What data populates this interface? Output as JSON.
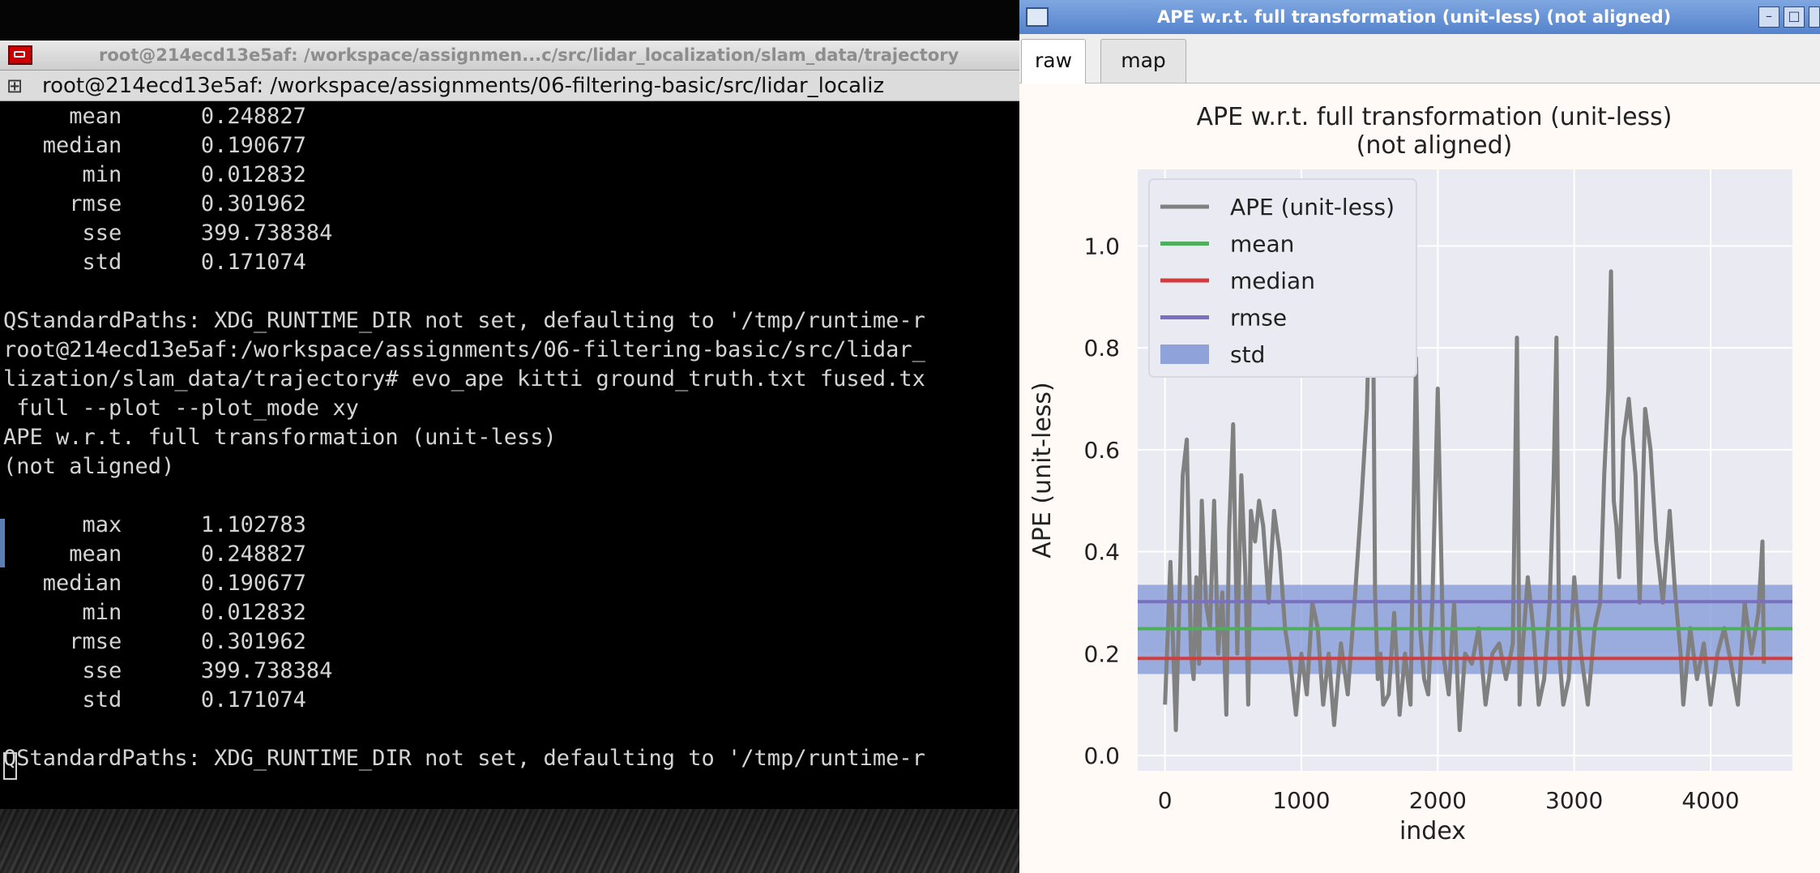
{
  "terminal": {
    "title": "root@214ecd13e5af: /workspace/assignmen...c/src/lidar_localization/slam_data/trajectory",
    "tab_label": "root@214ecd13e5af: /workspace/assignments/06-filtering-basic/src/lidar_localiz",
    "lines": [
      "     mean      0.248827",
      "   median      0.190677",
      "      min      0.012832",
      "     rmse      0.301962",
      "      sse      399.738384",
      "      std      0.171074",
      "",
      "QStandardPaths: XDG_RUNTIME_DIR not set, defaulting to '/tmp/runtime-r",
      "root@214ecd13e5af:/workspace/assignments/06-filtering-basic/src/lidar_",
      "lization/slam_data/trajectory# evo_ape kitti ground_truth.txt fused.tx",
      " full --plot --plot_mode xy",
      "APE w.r.t. full transformation (unit-less)",
      "(not aligned)",
      "",
      "      max      1.102783",
      "     mean      0.248827",
      "   median      0.190677",
      "      min      0.012832",
      "     rmse      0.301962",
      "      sse      399.738384",
      "      std      0.171074",
      "",
      "QStandardPaths: XDG_RUNTIME_DIR not set, defaulting to '/tmp/runtime-r"
    ]
  },
  "plot_window": {
    "title": "APE w.r.t. full transformation (unit-less) (not aligned)",
    "buttons": {
      "minimize": "–",
      "maximize": "□"
    },
    "tabs": [
      {
        "label": "raw",
        "active": true
      },
      {
        "label": "map",
        "active": false
      }
    ]
  },
  "chart_data": {
    "type": "line",
    "title": "APE w.r.t. full transformation (unit-less)",
    "subtitle": "(not aligned)",
    "xlabel": "index",
    "ylabel": "APE (unit-less)",
    "xlim": [
      -200,
      4600
    ],
    "ylim": [
      -0.03,
      1.15
    ],
    "xticks": [
      0,
      1000,
      2000,
      3000,
      4000
    ],
    "yticks": [
      0.0,
      0.2,
      0.4,
      0.6,
      0.8,
      1.0
    ],
    "grid": true,
    "legend_placement": "upper-left",
    "legend": [
      "APE (unit-less)",
      "mean",
      "median",
      "rmse",
      "std"
    ],
    "colors": {
      "ape": "#808080",
      "mean": "#4eae5b",
      "median": "#d23c3c",
      "rmse": "#7b6fbf",
      "std": "#7f97d6",
      "background": "#eaeaf2"
    },
    "stats": {
      "max": 1.102783,
      "mean": 0.248827,
      "median": 0.190677,
      "min": 0.012832,
      "rmse": 0.301962,
      "sse": 399.738384,
      "std": 0.171074
    },
    "series": [
      {
        "name": "APE (unit-less)",
        "x": [
          0,
          40,
          80,
          100,
          130,
          160,
          190,
          210,
          230,
          250,
          270,
          300,
          330,
          360,
          390,
          420,
          450,
          470,
          500,
          530,
          560,
          590,
          610,
          630,
          660,
          690,
          720,
          760,
          800,
          840,
          880,
          920,
          960,
          1000,
          1040,
          1080,
          1120,
          1160,
          1200,
          1240,
          1290,
          1340,
          1390,
          1440,
          1480,
          1520,
          1540,
          1560,
          1580,
          1600,
          1640,
          1680,
          1720,
          1760,
          1800,
          1840,
          1870,
          1900,
          1930,
          1960,
          2000,
          2040,
          2080,
          2120,
          2160,
          2200,
          2250,
          2300,
          2350,
          2400,
          2450,
          2500,
          2550,
          2580,
          2600,
          2620,
          2660,
          2700,
          2740,
          2780,
          2820,
          2850,
          2870,
          2890,
          2920,
          2960,
          3000,
          3050,
          3100,
          3150,
          3190,
          3220,
          3250,
          3270,
          3290,
          3310,
          3330,
          3360,
          3400,
          3450,
          3480,
          3520,
          3560,
          3600,
          3650,
          3700,
          3740,
          3780,
          3800,
          3850,
          3900,
          3950,
          4000,
          4050,
          4100,
          4150,
          4200,
          4250,
          4300,
          4350,
          4380,
          4390
        ],
        "values": [
          0.1,
          0.38,
          0.05,
          0.25,
          0.55,
          0.62,
          0.2,
          0.15,
          0.35,
          0.18,
          0.5,
          0.3,
          0.25,
          0.5,
          0.2,
          0.32,
          0.08,
          0.44,
          0.65,
          0.2,
          0.55,
          0.35,
          0.1,
          0.48,
          0.42,
          0.5,
          0.45,
          0.3,
          0.48,
          0.4,
          0.25,
          0.18,
          0.08,
          0.2,
          0.12,
          0.3,
          0.25,
          0.1,
          0.2,
          0.06,
          0.22,
          0.12,
          0.3,
          0.5,
          0.68,
          1.1,
          0.32,
          0.15,
          0.2,
          0.1,
          0.12,
          0.28,
          0.08,
          0.2,
          0.1,
          0.78,
          0.25,
          0.15,
          0.12,
          0.3,
          0.72,
          0.2,
          0.12,
          0.3,
          0.05,
          0.2,
          0.18,
          0.25,
          0.1,
          0.2,
          0.22,
          0.15,
          0.22,
          0.82,
          0.1,
          0.2,
          0.35,
          0.25,
          0.1,
          0.15,
          0.3,
          0.55,
          0.82,
          0.2,
          0.1,
          0.15,
          0.35,
          0.2,
          0.1,
          0.25,
          0.3,
          0.55,
          0.72,
          0.95,
          0.5,
          0.45,
          0.35,
          0.62,
          0.7,
          0.55,
          0.3,
          0.68,
          0.6,
          0.42,
          0.3,
          0.48,
          0.32,
          0.2,
          0.1,
          0.25,
          0.15,
          0.22,
          0.1,
          0.2,
          0.25,
          0.18,
          0.1,
          0.3,
          0.2,
          0.28,
          0.42,
          0.18
        ]
      },
      {
        "name": "mean",
        "value": 0.248827
      },
      {
        "name": "median",
        "value": 0.190677
      },
      {
        "name": "rmse",
        "value": 0.301962
      },
      {
        "name": "std",
        "low": 0.16,
        "high": 0.335
      }
    ]
  }
}
